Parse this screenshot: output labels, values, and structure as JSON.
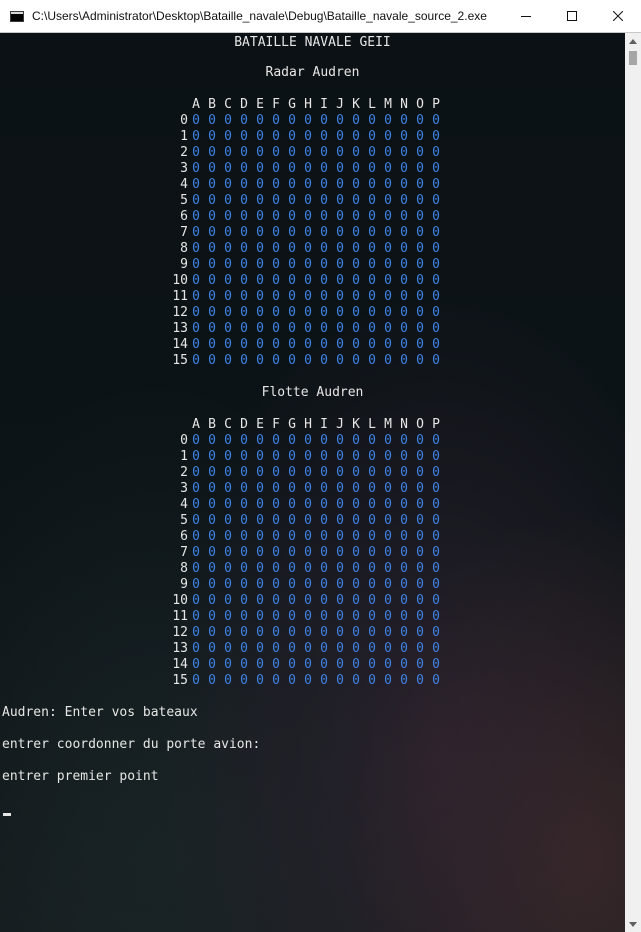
{
  "window": {
    "title": "C:\\Users\\Administrator\\Desktop\\Bataille_navale\\Debug\\Bataille_navale_source_2.exe"
  },
  "console": {
    "game_title": "BATAILLE NAVALE GEII",
    "radar_title": "Radar Audren",
    "fleet_title": "Flotte Audren",
    "columns": [
      "A",
      "B",
      "C",
      "D",
      "E",
      "F",
      "G",
      "H",
      "I",
      "J",
      "K",
      "L",
      "M",
      "N",
      "O",
      "P"
    ],
    "row_labels": [
      "0",
      "1",
      "2",
      "3",
      "4",
      "5",
      "6",
      "7",
      "8",
      "9",
      "10",
      "11",
      "12",
      "13",
      "14",
      "15"
    ],
    "radar_grid": [
      [
        "0",
        "0",
        "0",
        "0",
        "0",
        "0",
        "0",
        "0",
        "0",
        "0",
        "0",
        "0",
        "0",
        "0",
        "0",
        "0"
      ],
      [
        "0",
        "0",
        "0",
        "0",
        "0",
        "0",
        "0",
        "0",
        "0",
        "0",
        "0",
        "0",
        "0",
        "0",
        "0",
        "0"
      ],
      [
        "0",
        "0",
        "0",
        "0",
        "0",
        "0",
        "0",
        "0",
        "0",
        "0",
        "0",
        "0",
        "0",
        "0",
        "0",
        "0"
      ],
      [
        "0",
        "0",
        "0",
        "0",
        "0",
        "0",
        "0",
        "0",
        "0",
        "0",
        "0",
        "0",
        "0",
        "0",
        "0",
        "0"
      ],
      [
        "0",
        "0",
        "0",
        "0",
        "0",
        "0",
        "0",
        "0",
        "0",
        "0",
        "0",
        "0",
        "0",
        "0",
        "0",
        "0"
      ],
      [
        "0",
        "0",
        "0",
        "0",
        "0",
        "0",
        "0",
        "0",
        "0",
        "0",
        "0",
        "0",
        "0",
        "0",
        "0",
        "0"
      ],
      [
        "0",
        "0",
        "0",
        "0",
        "0",
        "0",
        "0",
        "0",
        "0",
        "0",
        "0",
        "0",
        "0",
        "0",
        "0",
        "0"
      ],
      [
        "0",
        "0",
        "0",
        "0",
        "0",
        "0",
        "0",
        "0",
        "0",
        "0",
        "0",
        "0",
        "0",
        "0",
        "0",
        "0"
      ],
      [
        "0",
        "0",
        "0",
        "0",
        "0",
        "0",
        "0",
        "0",
        "0",
        "0",
        "0",
        "0",
        "0",
        "0",
        "0",
        "0"
      ],
      [
        "0",
        "0",
        "0",
        "0",
        "0",
        "0",
        "0",
        "0",
        "0",
        "0",
        "0",
        "0",
        "0",
        "0",
        "0",
        "0"
      ],
      [
        "0",
        "0",
        "0",
        "0",
        "0",
        "0",
        "0",
        "0",
        "0",
        "0",
        "0",
        "0",
        "0",
        "0",
        "0",
        "0"
      ],
      [
        "0",
        "0",
        "0",
        "0",
        "0",
        "0",
        "0",
        "0",
        "0",
        "0",
        "0",
        "0",
        "0",
        "0",
        "0",
        "0"
      ],
      [
        "0",
        "0",
        "0",
        "0",
        "0",
        "0",
        "0",
        "0",
        "0",
        "0",
        "0",
        "0",
        "0",
        "0",
        "0",
        "0"
      ],
      [
        "0",
        "0",
        "0",
        "0",
        "0",
        "0",
        "0",
        "0",
        "0",
        "0",
        "0",
        "0",
        "0",
        "0",
        "0",
        "0"
      ],
      [
        "0",
        "0",
        "0",
        "0",
        "0",
        "0",
        "0",
        "0",
        "0",
        "0",
        "0",
        "0",
        "0",
        "0",
        "0",
        "0"
      ],
      [
        "0",
        "0",
        "0",
        "0",
        "0",
        "0",
        "0",
        "0",
        "0",
        "0",
        "0",
        "0",
        "0",
        "0",
        "0",
        "0"
      ]
    ],
    "fleet_grid": [
      [
        "0",
        "0",
        "0",
        "0",
        "0",
        "0",
        "0",
        "0",
        "0",
        "0",
        "0",
        "0",
        "0",
        "0",
        "0",
        "0"
      ],
      [
        "0",
        "0",
        "0",
        "0",
        "0",
        "0",
        "0",
        "0",
        "0",
        "0",
        "0",
        "0",
        "0",
        "0",
        "0",
        "0"
      ],
      [
        "0",
        "0",
        "0",
        "0",
        "0",
        "0",
        "0",
        "0",
        "0",
        "0",
        "0",
        "0",
        "0",
        "0",
        "0",
        "0"
      ],
      [
        "0",
        "0",
        "0",
        "0",
        "0",
        "0",
        "0",
        "0",
        "0",
        "0",
        "0",
        "0",
        "0",
        "0",
        "0",
        "0"
      ],
      [
        "0",
        "0",
        "0",
        "0",
        "0",
        "0",
        "0",
        "0",
        "0",
        "0",
        "0",
        "0",
        "0",
        "0",
        "0",
        "0"
      ],
      [
        "0",
        "0",
        "0",
        "0",
        "0",
        "0",
        "0",
        "0",
        "0",
        "0",
        "0",
        "0",
        "0",
        "0",
        "0",
        "0"
      ],
      [
        "0",
        "0",
        "0",
        "0",
        "0",
        "0",
        "0",
        "0",
        "0",
        "0",
        "0",
        "0",
        "0",
        "0",
        "0",
        "0"
      ],
      [
        "0",
        "0",
        "0",
        "0",
        "0",
        "0",
        "0",
        "0",
        "0",
        "0",
        "0",
        "0",
        "0",
        "0",
        "0",
        "0"
      ],
      [
        "0",
        "0",
        "0",
        "0",
        "0",
        "0",
        "0",
        "0",
        "0",
        "0",
        "0",
        "0",
        "0",
        "0",
        "0",
        "0"
      ],
      [
        "0",
        "0",
        "0",
        "0",
        "0",
        "0",
        "0",
        "0",
        "0",
        "0",
        "0",
        "0",
        "0",
        "0",
        "0",
        "0"
      ],
      [
        "0",
        "0",
        "0",
        "0",
        "0",
        "0",
        "0",
        "0",
        "0",
        "0",
        "0",
        "0",
        "0",
        "0",
        "0",
        "0"
      ],
      [
        "0",
        "0",
        "0",
        "0",
        "0",
        "0",
        "0",
        "0",
        "0",
        "0",
        "0",
        "0",
        "0",
        "0",
        "0",
        "0"
      ],
      [
        "0",
        "0",
        "0",
        "0",
        "0",
        "0",
        "0",
        "0",
        "0",
        "0",
        "0",
        "0",
        "0",
        "0",
        "0",
        "0"
      ],
      [
        "0",
        "0",
        "0",
        "0",
        "0",
        "0",
        "0",
        "0",
        "0",
        "0",
        "0",
        "0",
        "0",
        "0",
        "0",
        "0"
      ],
      [
        "0",
        "0",
        "0",
        "0",
        "0",
        "0",
        "0",
        "0",
        "0",
        "0",
        "0",
        "0",
        "0",
        "0",
        "0",
        "0"
      ],
      [
        "0",
        "0",
        "0",
        "0",
        "0",
        "0",
        "0",
        "0",
        "0",
        "0",
        "0",
        "0",
        "0",
        "0",
        "0",
        "0"
      ]
    ],
    "prompts": {
      "enter_ships": "Audren: Enter vos bateaux",
      "enter_carrier": "entrer coordonner du porte avion:",
      "first_point": "entrer premier point"
    }
  },
  "colors": {
    "cell_value": "#3f82e6",
    "console_text": "#e6e6e6",
    "console_background": "#0b1114",
    "titlebar_background": "#ffffff"
  },
  "icons": {
    "app": "console-window-icon",
    "minimize": "minimize-icon",
    "maximize": "maximize-icon",
    "close": "close-icon",
    "scroll_up": "scroll-up-arrow-icon",
    "scroll_down": "scroll-down-arrow-icon"
  }
}
